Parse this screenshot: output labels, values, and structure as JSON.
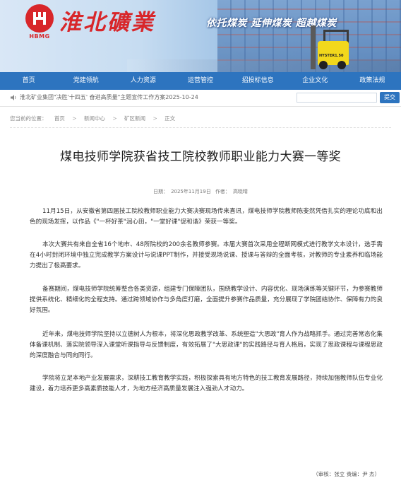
{
  "header": {
    "logo_sub": "HBMG",
    "logo_cn": "淮北礦業",
    "slogan": "依托煤炭  延伸煤炭  超越煤炭",
    "forklift_brand": "HYSTER1.50"
  },
  "nav": {
    "items": [
      "首页",
      "党建领航",
      "人力资源",
      "运营管控",
      "招投标信息",
      "企业文化",
      "政策法规"
    ]
  },
  "notice": {
    "text": "淮北矿业集团\"决胜'十四五' 奋进高质量\"主题宣传工作方案2025-10-24",
    "search_placeholder": "",
    "submit_label": "提交"
  },
  "breadcrumb": {
    "prefix": "您当前的位置：",
    "items": [
      "首页",
      "新闻中心",
      "矿区新闻",
      "正文"
    ],
    "separator": ">"
  },
  "article": {
    "title": "煤电技师学院获省技工院校教师职业能力大赛一等奖",
    "date_label": "日期：",
    "date": "2025年11月19日",
    "author_label": "作者：",
    "author": "高晓晴",
    "paragraphs": [
      "11月15日，从安徽省第四届技工院校教师职业能力大赛决赛现场传来喜讯，煤电技师学院教师陈斐然凭借扎实的理论功底和出色的现场发挥，以作品《\"一杯好茶\"润心田，\"一堂好课\"促和谐》荣获一等奖。",
      "本次大赛共有来自全省16个地市、48所院校的200余名教师参赛。本届大赛首次采用全程断网模式进行教学文本设计，选手需在4小时封闭环境中独立完成教学方案设计与说课PPT制作，并接受现场说课、授课与答辩的全面考核，对教师的专业素养和临场能力提出了极高要求。",
      "备赛期间，煤电技师学院统筹整合各类资源，组建专门保障团队，围绕教学设计、内容优化、现场演练等关键环节，为参赛教师提供系统化、精细化的全程支持。通过跨领域协作与多角度打磨，全面提升参赛作品质量，充分展现了学院团结协作、保障有力的良好氛围。",
      "近年来，煤电技师学院坚持以立德树人为根本，将深化思政教学改革、系统塑造\"大思政\"育人作为战略抓手。通过完善常态化集体备课机制、落实院领导深入课堂听课指导与反馈制度，有效拓展了\"大思政课\"的实践路径与育人格局，实现了思政课程与课程思政的深度融合与同向同行。",
      "学院将立足本地产业发展需求，深耕技工教育教学实践，积极探索具有地方特色的技工教育发展路径，持续加强教师队伍专业化建设，着力培养更多高素质技能人才，为地方经济高质量发展注入强劲人才动力。"
    ],
    "footer_note": "（审核：张立 责编：尹 杰）"
  },
  "colors": {
    "brand_red": "#d8262a",
    "nav_blue": "#2d74bf"
  }
}
